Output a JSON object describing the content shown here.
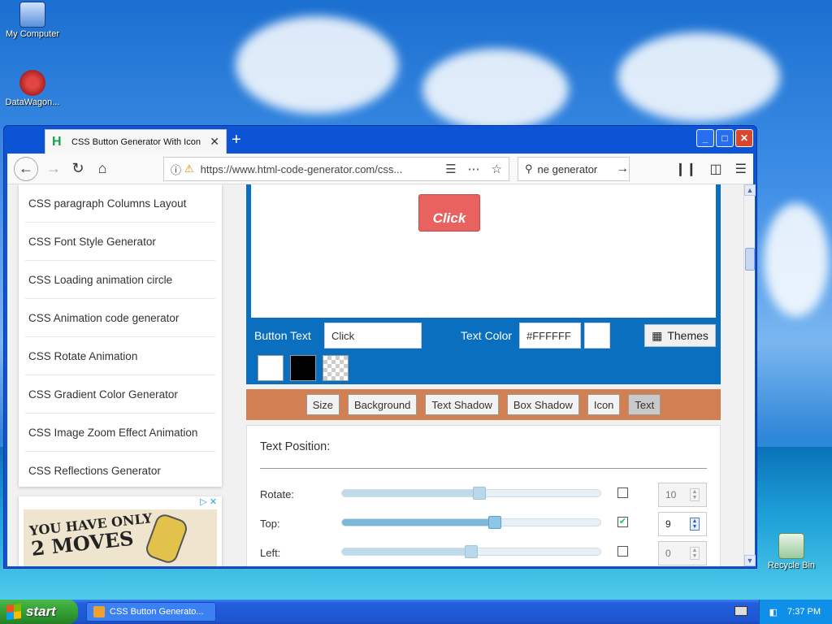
{
  "desktop": {
    "icons": [
      {
        "label": "My Computer"
      },
      {
        "label": "DataWagon..."
      },
      {
        "label": "Recycle Bin"
      }
    ]
  },
  "browser": {
    "tab_title": "CSS Button Generator With Icon",
    "favicon_letter": "H",
    "new_tab_symbol": "+",
    "window_buttons": {
      "minimize": "_",
      "maximize": "□",
      "close": "✕"
    },
    "url": "https://www.html-code-generator.com/css...",
    "search_text": "ne generator"
  },
  "sidebar": {
    "items": [
      {
        "label": "CSS paragraph Columns Layout"
      },
      {
        "label": "CSS Font Style Generator"
      },
      {
        "label": "CSS Loading animation circle"
      },
      {
        "label": "CSS Animation code generator"
      },
      {
        "label": "CSS Rotate Animation"
      },
      {
        "label": "CSS Gradient Color Generator"
      },
      {
        "label": "CSS Image Zoom Effect Animation"
      },
      {
        "label": "CSS Reflections Generator"
      }
    ]
  },
  "ad": {
    "line1": "YOU HAVE ONLY",
    "line2": "2 MOVES"
  },
  "generator": {
    "preview_button_text": "Click",
    "button_text_label": "Button Text",
    "button_text_value": "Click",
    "text_color_label": "Text Color",
    "text_color_value": "#FFFFFF",
    "themes_label": "Themes",
    "swatch_colors": [
      "#FFFFFF",
      "#000000",
      "transparent"
    ]
  },
  "tabs": [
    {
      "label": "Size",
      "active": false
    },
    {
      "label": "Background",
      "active": false
    },
    {
      "label": "Text Shadow",
      "active": false
    },
    {
      "label": "Box Shadow",
      "active": false
    },
    {
      "label": "Icon",
      "active": false
    },
    {
      "label": "Text",
      "active": true
    }
  ],
  "text_position": {
    "title": "Text Position:",
    "rows": [
      {
        "label": "Rotate:",
        "slider_fraction": 0.53,
        "enabled": false,
        "value": "10"
      },
      {
        "label": "Top:",
        "slider_fraction": 0.59,
        "enabled": true,
        "value": "9"
      },
      {
        "label": "Left:",
        "slider_fraction": 0.5,
        "enabled": false,
        "value": "0"
      }
    ]
  },
  "taskbar": {
    "start_label": "start",
    "task_label": "CSS Button Generato...",
    "clock": "7:37 PM"
  },
  "colors": {
    "preview_panel": "#0a6fbe",
    "tabs_bar": "#d27f54",
    "demo_button": "#e8625f"
  }
}
